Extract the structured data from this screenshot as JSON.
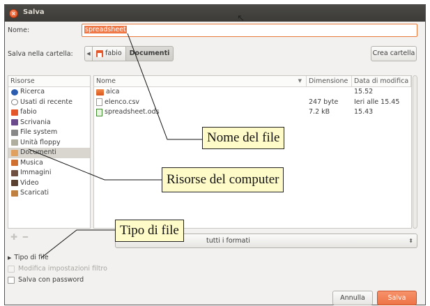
{
  "window": {
    "title": "Salva"
  },
  "form": {
    "name_label": "Nome:",
    "name_value": "spreadsheet",
    "folder_label": "Salva nella cartella:",
    "path": [
      "fabio",
      "Documenti"
    ],
    "create_folder": "Crea cartella"
  },
  "places": {
    "header": "Risorse",
    "items": [
      {
        "label": "Ricerca",
        "icon": "search-icon",
        "color": "#2a5db0"
      },
      {
        "label": "Usati di recente",
        "icon": "clock-icon",
        "color": "#7a7a7a"
      },
      {
        "label": "fabio",
        "icon": "home-folder-icon",
        "color": "#e4572b"
      },
      {
        "label": "Scrivania",
        "icon": "desktop-icon",
        "color": "#6a4a8a"
      },
      {
        "label": "File system",
        "icon": "drive-icon",
        "color": "#888888"
      },
      {
        "label": "Unità floppy",
        "icon": "floppy-icon",
        "color": "#b0ae9f"
      },
      {
        "label": "Documenti",
        "icon": "documents-folder-icon",
        "color": "#e0a060"
      },
      {
        "label": "Musica",
        "icon": "music-folder-icon",
        "color": "#d07030"
      },
      {
        "label": "Immagini",
        "icon": "pictures-folder-icon",
        "color": "#705040"
      },
      {
        "label": "Video",
        "icon": "video-folder-icon",
        "color": "#5a4030"
      },
      {
        "label": "Scaricati",
        "icon": "downloads-folder-icon",
        "color": "#c08040"
      }
    ]
  },
  "files": {
    "columns": [
      "Nome",
      "Dimensione",
      "Data di modifica"
    ],
    "rows": [
      {
        "name": "aica",
        "type": "folder",
        "size": "",
        "date": "15.52"
      },
      {
        "name": "elenco.csv",
        "type": "text",
        "size": "247 byte",
        "date": "Ieri alle 15.45"
      },
      {
        "name": "spreadsheet.ods",
        "type": "spreadsheet",
        "size": "7.2 kB",
        "date": "15.43"
      }
    ]
  },
  "filter": {
    "value": "tutti i formati"
  },
  "options": {
    "file_type_expander": "Tipo di file",
    "modify_filter": "Modifica impostazioni filtro",
    "save_with_password": "Salva con password"
  },
  "buttons": {
    "cancel": "Annulla",
    "save": "Salva"
  },
  "callouts": {
    "file_name": "Nome del file",
    "computer_resources": "Risorse del computer",
    "file_type": "Tipo di file"
  },
  "colors": {
    "accent": "#f07746",
    "title_bg": "#3c3b37",
    "callout_bg": "#fffbc8"
  }
}
